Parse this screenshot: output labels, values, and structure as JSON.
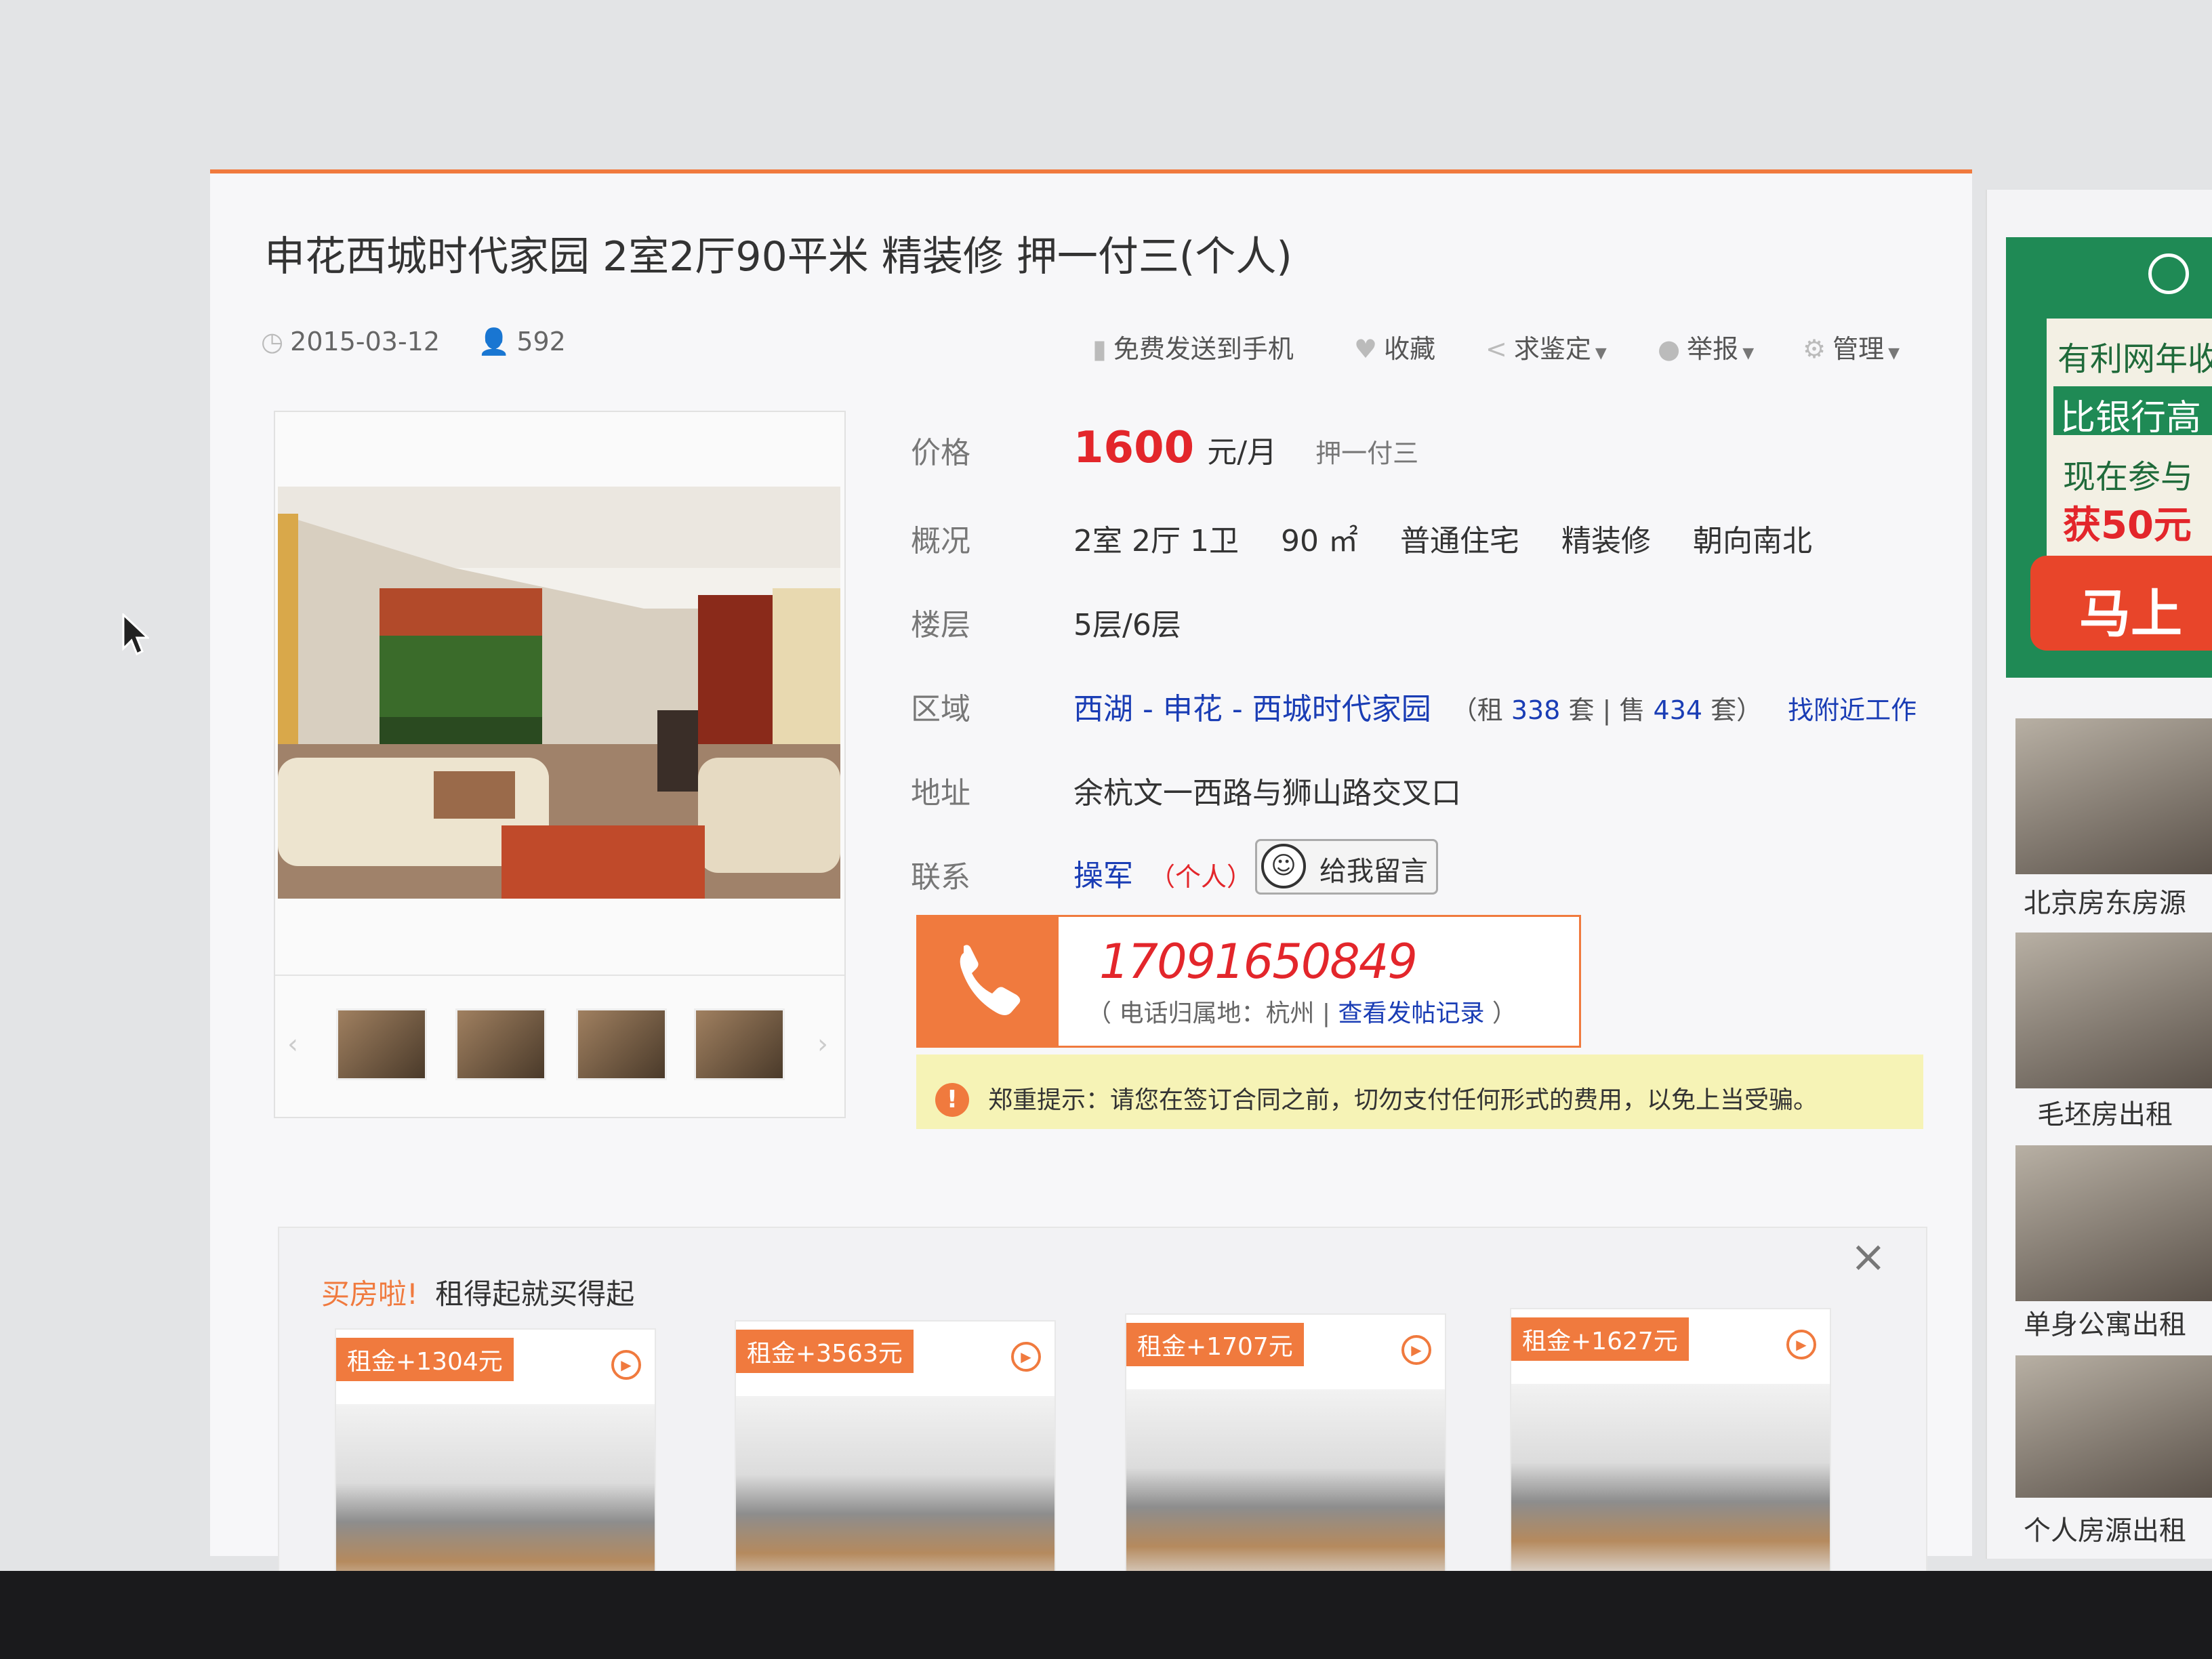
{
  "listing": {
    "title": "申花西城时代家园 2室2厅90平米 精装修 押一付三(个人)",
    "date": "2015-03-12",
    "views": "592"
  },
  "toolbar": {
    "send_to_phone": "免费发送到手机",
    "favorite": "收藏",
    "appraise": "求鉴定",
    "report": "举报",
    "manage": "管理"
  },
  "details": {
    "price_label": "价格",
    "price": "1600",
    "price_unit": "元/月",
    "payment": "押一付三",
    "overview_label": "概况",
    "rooms": "2室 2厅 1卫",
    "area": "90 ㎡",
    "house_type": "普通住宅",
    "decoration": "精装修",
    "orientation": "朝向南北",
    "floor_label": "楼层",
    "floor": "5层/6层",
    "region_label": "区域",
    "region_district": "西湖",
    "region_sep1": " - ",
    "region_sub": "申花",
    "region_sep2": " - ",
    "region_estate": "西城时代家园",
    "rent_prefix": "（租",
    "rent_count": "338",
    "rent_suffix": "套 | 售",
    "sale_count": "434",
    "sale_suffix": "套）",
    "nearby_jobs": "找附近工作",
    "address_label": "地址",
    "address": "余杭文一西路与狮山路交叉口",
    "contact_label": "联系",
    "contact_name": "操军",
    "contact_type": "（个人）",
    "message_button": "给我留言"
  },
  "phone": {
    "number": "17091650849",
    "location_prefix": "（ 电话归属地：杭州  | ",
    "history_link": "查看发帖记录",
    "location_suffix": " ）"
  },
  "warning": {
    "title": "郑重提示：",
    "text": "请您在签订合同之前，切勿支付任何形式的费用，以免上当受骗。"
  },
  "promo": {
    "title_accent": "买房啦!",
    "title": "租得起就买得起",
    "close": "×",
    "cards": [
      {
        "badge": "租金+1304元"
      },
      {
        "badge": "租金+3563元"
      },
      {
        "badge": "租金+1707元"
      },
      {
        "badge": "租金+1627元"
      }
    ]
  },
  "sidebar": {
    "ad_line1": "有利网年收",
    "ad_line2": "比银行高",
    "ad_line3": "现在参与",
    "ad_line4": "获50元",
    "ad_button": "马上",
    "items": [
      {
        "caption": "北京房东房源"
      },
      {
        "caption": "毛坯房出租"
      },
      {
        "caption": "单身公寓出租"
      },
      {
        "caption": "个人房源出租"
      }
    ]
  },
  "colors": {
    "accent": "#f07a3e",
    "price": "#e3262b",
    "link": "#1a3db5",
    "ad_green": "#1f8a55"
  }
}
